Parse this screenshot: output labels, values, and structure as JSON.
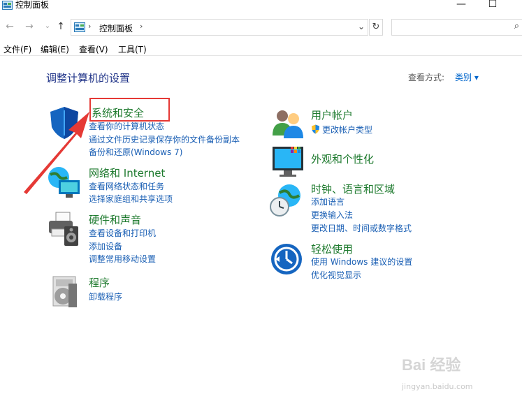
{
  "window": {
    "title": "控制面板",
    "minimize_glyph": "—",
    "maximize_glyph": "☐"
  },
  "address": {
    "back_glyph": "←",
    "forward_glyph": "→",
    "recent_glyph": "⌄",
    "up_glyph": "↑",
    "crumb": "控制面板",
    "sep": "›",
    "dropdown_glyph": "⌄",
    "refresh_glyph": "↻",
    "search_placeholder": "",
    "search_glyph": "⌕"
  },
  "menu": [
    "文件(F)",
    "编辑(E)",
    "查看(V)",
    "工具(T)"
  ],
  "heading": "调整计算机的设置",
  "view_by": {
    "label": "查看方式:",
    "value": "类别 ▾"
  },
  "left_categories": [
    {
      "title": "系统和安全",
      "icon": "shield-icon",
      "links": [
        "查看你的计算机状态",
        "通过文件历史记录保存你的文件备份副本",
        "备份和还原(Windows 7)"
      ]
    },
    {
      "title": "网络和 Internet",
      "icon": "network-globe-icon",
      "links": [
        "查看网络状态和任务",
        "选择家庭组和共享选项"
      ]
    },
    {
      "title": "硬件和声音",
      "icon": "printer-speaker-icon",
      "links": [
        "查看设备和打印机",
        "添加设备",
        "调整常用移动设置"
      ]
    },
    {
      "title": "程序",
      "icon": "programs-disc-icon",
      "links": [
        "卸载程序"
      ]
    }
  ],
  "right_categories": [
    {
      "title": "用户帐户",
      "icon": "users-icon",
      "links": [
        "更改帐户类型"
      ]
    },
    {
      "title": "外观和个性化",
      "icon": "monitor-personalize-icon",
      "links": []
    },
    {
      "title": "时钟、语言和区域",
      "icon": "clock-globe-icon",
      "links": [
        "添加语言",
        "更换输入法",
        "更改日期、时间或数字格式"
      ]
    },
    {
      "title": "轻松使用",
      "icon": "ease-of-access-icon",
      "links": [
        "使用 Windows 建议的设置",
        "优化视觉显示"
      ]
    }
  ],
  "watermark": {
    "text": "Bai 经验",
    "url": "jingyan.baidu.com"
  },
  "colors": {
    "heading": "#1e3287",
    "category": "#1e7a2e",
    "link": "#1a5fb4",
    "highlight": "#e53935"
  }
}
